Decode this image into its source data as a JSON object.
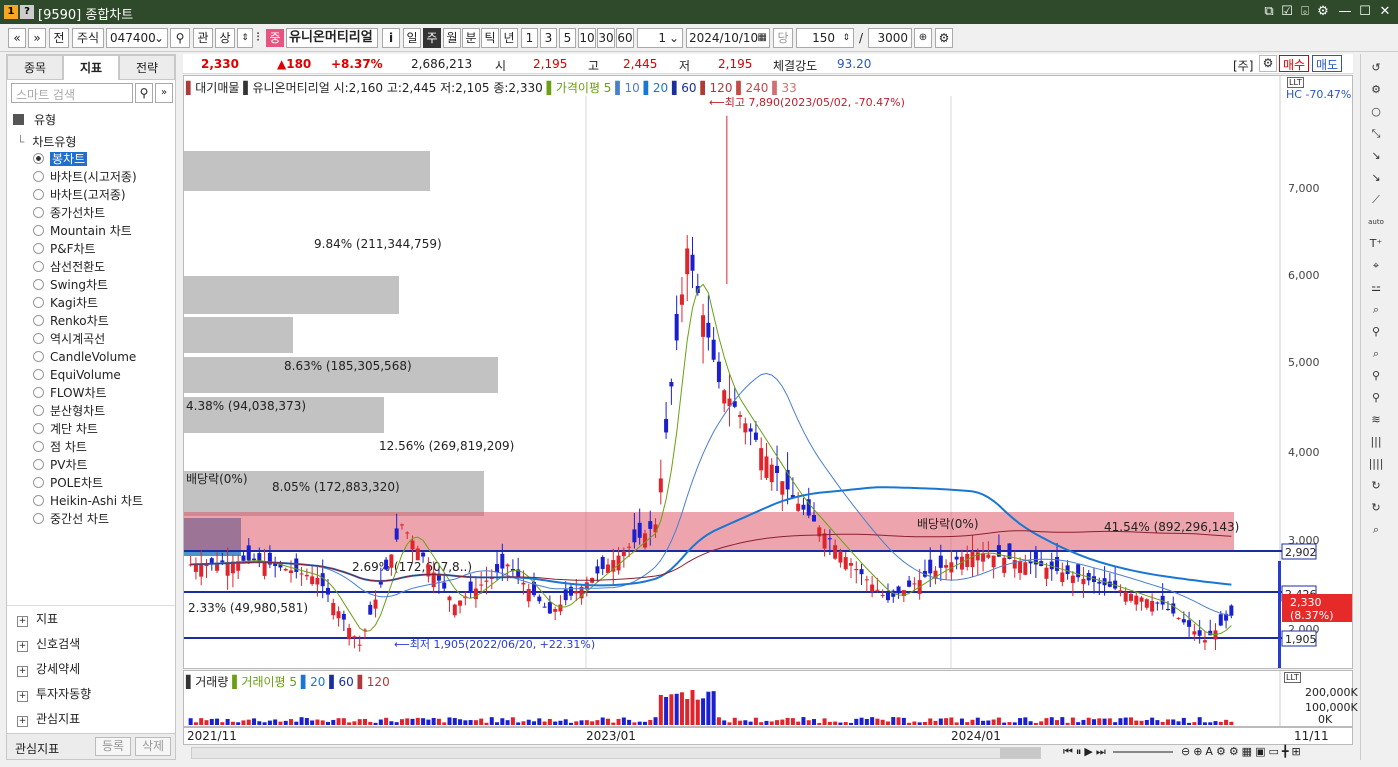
{
  "window": {
    "title": "[9590] 종합차트",
    "icons": [
      "1",
      "?"
    ],
    "controls": [
      "new-window-icon",
      "check-icon",
      "screenshot-icon",
      "gear-icon",
      "minimize-icon",
      "maximize-icon",
      "close-icon"
    ]
  },
  "toolbar": {
    "prev": "«",
    "down": "»",
    "jeon": "전",
    "type": "주식",
    "code": "047400",
    "gwan": "관",
    "sang": "상",
    "stock_badge": "중",
    "stock_name": "유니온머티리얼",
    "info": "i",
    "periods": [
      "일",
      "주",
      "월",
      "분",
      "틱",
      "년"
    ],
    "selected_period": "주",
    "minutes": [
      "1",
      "3",
      "5",
      "10",
      "30",
      "60"
    ],
    "period_count": "1",
    "date": "2024/10/10",
    "dang": "당",
    "count": "150",
    "slash": "/",
    "max": "3000"
  },
  "left": {
    "tabs": [
      "종목",
      "지표",
      "전략"
    ],
    "selected_tab": "지표",
    "search_placeholder": "스마트 검색",
    "section_title": "유형",
    "tree_title": "차트유형",
    "chart_types": [
      "봉차트",
      "바차트(시고저종)",
      "바차트(고저종)",
      "종가선차트",
      "Mountain 차트",
      "P&F차트",
      "삼선전환도",
      "Swing차트",
      "Kagi차트",
      "Renko차트",
      "역시계곡선",
      "CandleVolume",
      "EquiVolume",
      "FLOW차트",
      "분산형차트",
      "계단 차트",
      "점 차트",
      "PV차트",
      "POLE차트",
      "Heikin-Ashi 차트",
      "중간선 차트"
    ],
    "selected_type": "봉차트",
    "sections": [
      "지표",
      "신호검색",
      "강세약세",
      "투자자동향",
      "관심지표"
    ],
    "footer_label": "관심지표",
    "footer_buttons": [
      "등록",
      "삭제"
    ]
  },
  "quote": {
    "price": "2,330",
    "change": "▲180",
    "pct": "+8.37%",
    "volume": "2,686,213",
    "open_label": "시",
    "open": "2,195",
    "high_label": "고",
    "high": "2,445",
    "low_label": "저",
    "low": "2,195",
    "strength_label": "체결강도",
    "strength": "93.20",
    "main": "[주]",
    "buy": "매수",
    "sell": "매도"
  },
  "chart": {
    "legend_prefix": "대기매물",
    "name_line": "유니온머티리얼 시:2,160 고:2,445 저:2,105 종:2,330",
    "ma_label": "가격이평 5",
    "ma": [
      "10",
      "20",
      "60",
      "120",
      "240",
      "33"
    ],
    "ma_colors": [
      "#6aa012",
      "#4a7fd0",
      "#1976d2",
      "#1a2f9e",
      "#b03a3a",
      "#c84848",
      "#d07070"
    ],
    "hc": "HC -70.47%",
    "high_note": "⟵최고 7,890(2023/05/02, -70.47%)",
    "low_note": "⟵최저 1,905(2022/06/20, +22.31%)",
    "dividend1": "배당락(0%)",
    "dividend2": "배당락(0%)",
    "dividend3": "배당락(0%)",
    "price_axis": [
      "7,000",
      "6,000",
      "5,000",
      "4,000",
      "3,000",
      "2,000"
    ],
    "level_labels": [
      "2,902",
      "2,426",
      "1,905"
    ],
    "current_label": "2,330",
    "current_pct": "(8.37%)",
    "profile": [
      {
        "label": "9.84% (211,344,759)",
        "value": 9.84
      },
      {
        "label": "8.63% (185,305,568)",
        "value": 8.63
      },
      {
        "label": "4.38% (94,038,373)",
        "value": 4.38
      },
      {
        "label": "12.56% (269,819,209)",
        "value": 12.56
      },
      {
        "label": "8.05% (172,883,320)",
        "value": 8.05
      },
      {
        "label": "41.54% (892,296,143)",
        "value": 41.54
      },
      {
        "label": "2.69% (172,607,8..)",
        "value": 2.69
      },
      {
        "label": "2.33% (49,980,581)",
        "value": 2.33
      }
    ],
    "volume": {
      "title": "거래량",
      "ma_label": "거래이평 5",
      "ma": [
        "20",
        "60",
        "120"
      ],
      "axis": [
        "200,000K",
        "100,000K",
        "0K"
      ]
    },
    "x_axis": [
      "2021/11",
      "2023/01",
      "2024/01",
      "11/11"
    ]
  },
  "chart_data": {
    "type": "candlestick",
    "instrument": "유니온머티리얼",
    "interval": "weekly",
    "ylim": [
      1800,
      8000
    ],
    "high": {
      "price": 7890,
      "date": "2023/05/02"
    },
    "low": {
      "price": 1905,
      "date": "2022/06/20"
    },
    "last": {
      "open": 2160,
      "high": 2445,
      "low": 2105,
      "close": 2330
    },
    "levels": [
      2902,
      2426,
      1905
    ]
  }
}
